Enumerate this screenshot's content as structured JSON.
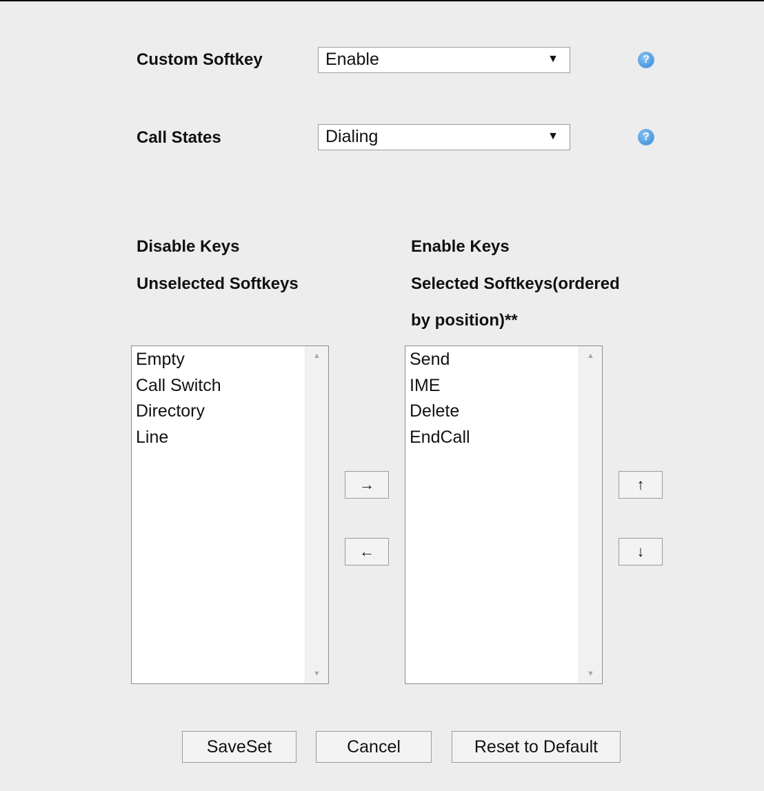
{
  "custom_softkey": {
    "label": "Custom Softkey",
    "value": "Enable",
    "arrow": "▼"
  },
  "call_states": {
    "label": "Call States",
    "value": "Dialing",
    "arrow": "▼"
  },
  "help_icon_glyph": "?",
  "disabled": {
    "heading": "Disable Keys",
    "subheading": "Unselected Softkeys",
    "items": [
      "Empty",
      "Call Switch",
      "Directory",
      "Line"
    ]
  },
  "enabled": {
    "heading": "Enable Keys",
    "subheading_line1": "Selected Softkeys(ordered",
    "subheading_line2": "by position)**",
    "items": [
      "Send",
      "IME",
      "Delete",
      "EndCall"
    ]
  },
  "transfer": {
    "move_right": "→",
    "move_left": "←"
  },
  "order": {
    "move_up": "↑",
    "move_down": "↓"
  },
  "scroll": {
    "up": "▲",
    "down": "▼"
  },
  "actions": {
    "save": "SaveSet",
    "cancel": "Cancel",
    "reset": "Reset to Default"
  }
}
